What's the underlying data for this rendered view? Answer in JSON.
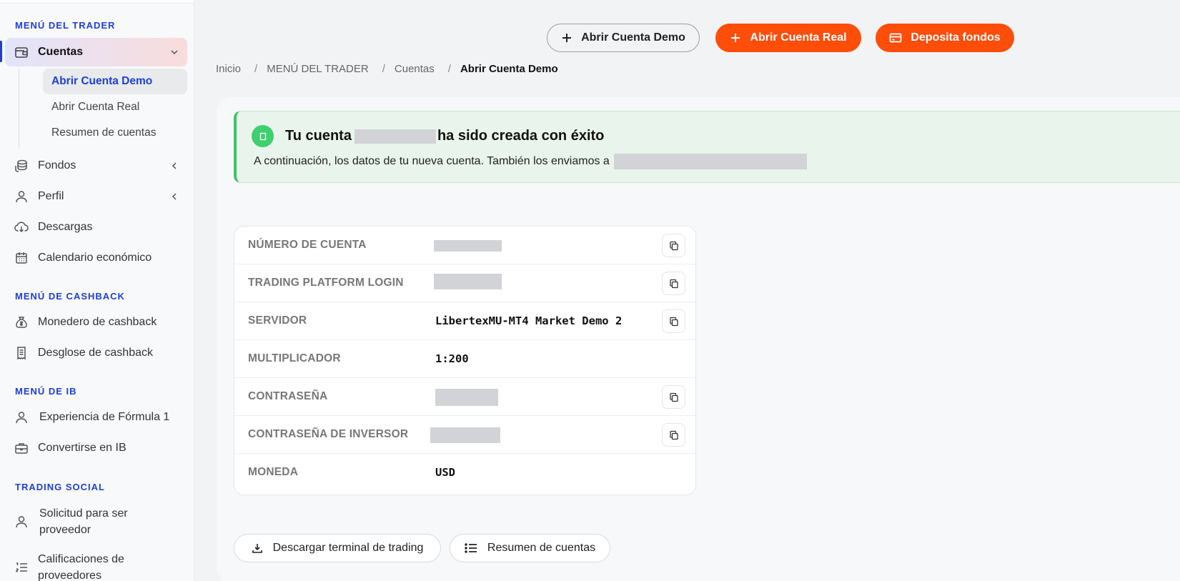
{
  "sidebar": {
    "sections": {
      "trader": "MENÚ DEL TRADER",
      "cashback": "MENÚ DE CASHBACK",
      "ib": "MENÚ DE IB",
      "social": "TRADING SOCIAL"
    },
    "cuentas": {
      "label": "Cuentas",
      "sub": [
        "Abrir Cuenta Demo",
        "Abrir Cuenta Real",
        "Resumen de cuentas"
      ]
    },
    "items": {
      "fondos": "Fondos",
      "perfil": "Perfil",
      "descargas": "Descargas",
      "calendario": "Calendario económico",
      "monedero": "Monedero de cashback",
      "desglose": "Desglose de cashback",
      "formula": "Experiencia de Fórmula 1",
      "convertirse": "Convertirse en IB",
      "solicitud_1": "Solicitud para ser",
      "solicitud_2": "proveedor",
      "calificaciones_1": "Calificaciones de",
      "calificaciones_2": "proveedores"
    }
  },
  "header": {
    "demo_button": "Abrir Cuenta Demo",
    "real_button": "Abrir Cuenta Real",
    "deposit_button": "Deposita fondos",
    "accent": "#ff4d0a"
  },
  "breadcrumb": [
    "Inicio",
    "MENÚ DEL TRADER",
    "Cuentas",
    "Abrir Cuenta Demo"
  ],
  "alert": {
    "title_prefix": "Tu cuenta",
    "title_suffix": "ha sido creada con éxito",
    "description": "A continuación, los datos de tu nueva cuenta. También los enviamos a"
  },
  "account": {
    "rows": [
      {
        "label": "NÚMERO DE CUENTA",
        "value": "",
        "redacted": true
      },
      {
        "label": "TRADING PLATFORM LOGIN",
        "value": "",
        "redacted": true
      },
      {
        "label": "SERVIDOR",
        "value": "LibertexMU-MT4 Market Demo 2",
        "redacted": false
      },
      {
        "label": "MULTIPLICADOR",
        "value": "1:200",
        "redacted": false
      },
      {
        "label": "CONTRASEÑA",
        "value": "",
        "redacted": true
      },
      {
        "label": "CONTRASEÑA DE INVERSOR",
        "value": "",
        "redacted": true
      },
      {
        "label": "MONEDA",
        "value": "USD",
        "redacted": false
      }
    ]
  },
  "footer": {
    "download_button": "Descargar terminal de trading",
    "summary_button": "Resumen de cuentas"
  }
}
